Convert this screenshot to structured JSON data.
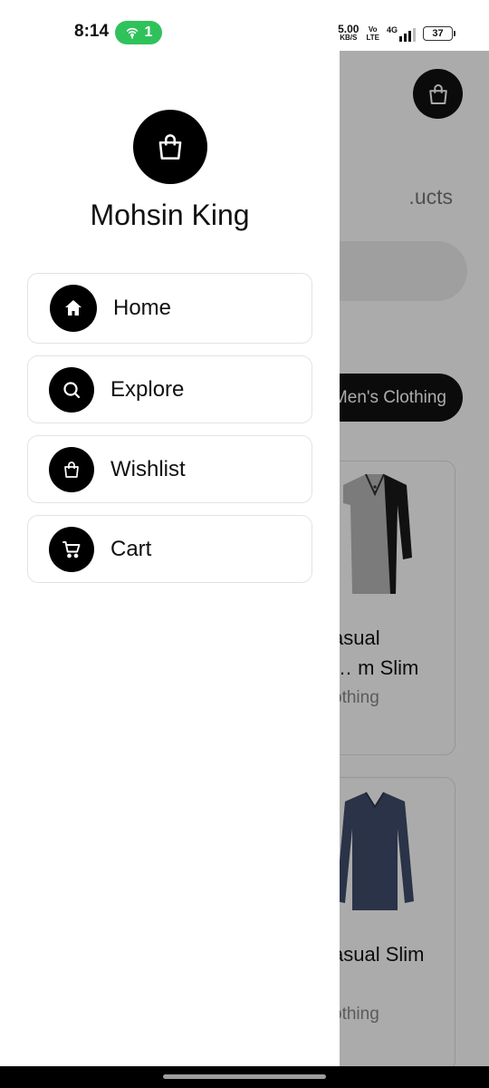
{
  "status_bar": {
    "time": "8:14",
    "hotspot_count": "1",
    "net_speed_value": "5.00",
    "net_speed_unit": "KB/S",
    "volte_top": "Vo",
    "volte_bottom": "LTE",
    "network_type": "4G",
    "battery": "37",
    "hotspot_color": "#2fc25b"
  },
  "background": {
    "subtitle": "ucts.",
    "category_chip": "Men's Clothing",
    "products": [
      {
        "title_line1": "asual",
        "title_line2": "m Slim …",
        "category": "othing"
      },
      {
        "title_line1": "asual Slim",
        "title_line2": "",
        "category": "othing"
      }
    ]
  },
  "drawer": {
    "user_name": "Mohsin King",
    "avatar_icon": "shopping-bag-icon",
    "menu": [
      {
        "label": "Home",
        "icon": "home-icon"
      },
      {
        "label": "Explore",
        "icon": "search-icon"
      },
      {
        "label": "Wishlist",
        "icon": "shopping-bag-icon"
      },
      {
        "label": "Cart",
        "icon": "cart-icon"
      }
    ]
  }
}
